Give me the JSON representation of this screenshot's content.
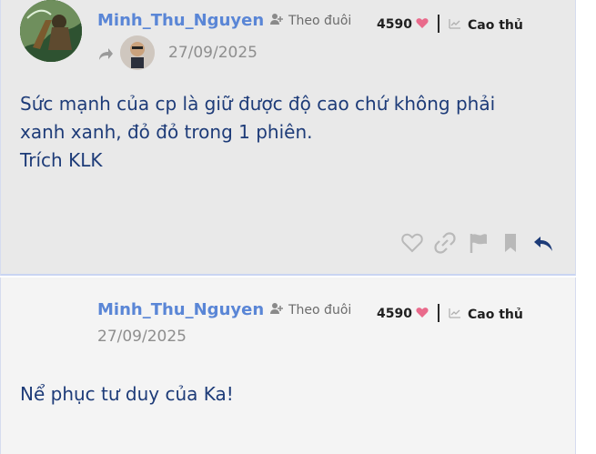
{
  "posts": [
    {
      "username": "Minh_Thu_Nguyen",
      "follow_label": "Theo đuôi",
      "score": "4590",
      "rank": "Cao thủ",
      "date": "27/09/2025",
      "content_lines": [
        "Sức mạnh của cp là giữ được độ cao chứ không phải",
        "xanh xanh, đỏ đỏ trong 1 phiên.",
        "Trích KLK"
      ],
      "icons": {
        "follow": "add-user-icon",
        "heart": "heart-icon",
        "rank": "chart-icon",
        "repost": "share-arrow-icon",
        "like": "heart-outline-icon",
        "link": "link-icon",
        "flag": "flag-icon",
        "bookmark": "bookmark-icon",
        "reply": "reply-icon"
      }
    },
    {
      "username": "Minh_Thu_Nguyen",
      "follow_label": "Theo đuôi",
      "score": "4590",
      "rank": "Cao thủ",
      "date": "27/09/2025",
      "content_lines": [
        "Nể phục tư duy của Ka!"
      ],
      "icons": {
        "follow": "add-user-icon",
        "heart": "heart-icon",
        "rank": "chart-icon"
      }
    }
  ],
  "colors": {
    "username": "#5a86d6",
    "content": "#1d3b78",
    "heart": "#e96a8b",
    "reply": "#1d3b78",
    "icon_gray": "#b9b9b9"
  }
}
